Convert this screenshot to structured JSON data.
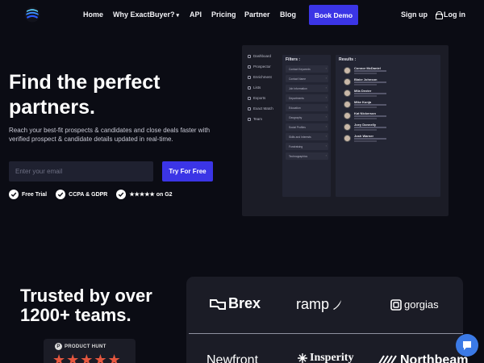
{
  "nav": {
    "links": [
      "Home",
      "Why ExactBuyer?",
      "API",
      "Pricing",
      "Partner",
      "Blog"
    ],
    "book_demo": "Book Demo",
    "sign_up": "Sign up",
    "log_in": "Log in"
  },
  "hero": {
    "title": "Find the perfect partners.",
    "subtitle": "Reach your best-fit prospects & candidates and close deals faster with verified prospect & candidate details updated in real-time.",
    "email_placeholder": "Enter your email",
    "cta": "Try For Free",
    "badges": [
      "Free Trial",
      "CCPA & GDPR",
      "★★★★★ on G2"
    ]
  },
  "preview": {
    "sidebar": [
      "Dashboard",
      "Prospector",
      "Enrichment",
      "Lists",
      "Exports",
      "Exact Match",
      "Team"
    ],
    "filters_title": "Filters :",
    "filters": [
      "Contact Keywords",
      "Contact Name",
      "Job Information",
      "Departments",
      "Education",
      "Geography",
      "Social Profiles",
      "Skills and Interests",
      "Fundraising",
      "Technographics"
    ],
    "results_title": "Results :",
    "results": [
      "Connor McDaniel",
      "Blake Johnson",
      "Mila Dexter",
      "Mike Kunja",
      "Kat Nickerson",
      "Joey Donnelly",
      "Josh Warner"
    ]
  },
  "trusted": {
    "title": "Trusted by over 1200+ teams.",
    "product_hunt_label": "PRODUCT HUNT",
    "product_hunt_stars": "★★★★★"
  },
  "logos": [
    "Brex",
    "ramp",
    "gorgias",
    "Newfront",
    "Insperity",
    "Northbeam"
  ],
  "colors": {
    "accent": "#3b35e6",
    "background": "#0b0c14",
    "panel": "#1b1c26",
    "chat": "#3b7ae6",
    "stars": "#e6573f"
  },
  "icons": {
    "logo": "stack-logo-icon",
    "lock": "lock-icon",
    "check": "check-circle-icon",
    "chat": "chat-bubble-icon",
    "product_hunt": "product-hunt-icon"
  }
}
